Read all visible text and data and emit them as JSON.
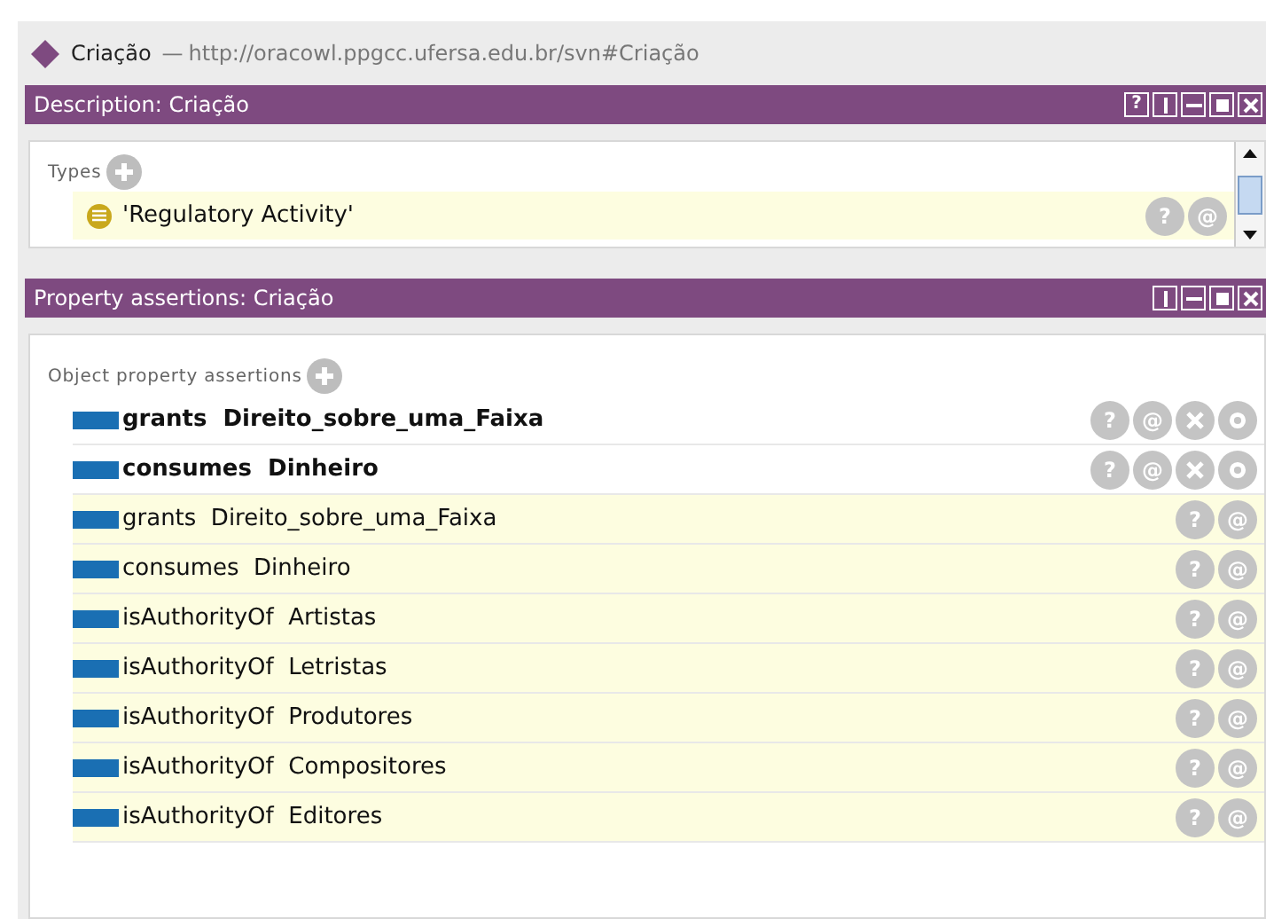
{
  "entity": {
    "name": "Criação",
    "separator": "—",
    "iri": "http://oracowl.ppgcc.ufersa.edu.br/svn#Criação"
  },
  "description": {
    "title": "Description: Criação",
    "header_buttons": [
      "?"
    ],
    "section": "Types",
    "types": [
      {
        "label": "'Regulatory Activity'",
        "buttons": [
          "?",
          "@"
        ]
      }
    ]
  },
  "property_assertions": {
    "title": "Property assertions: Criação",
    "section": "Object property assertions",
    "rows": [
      {
        "property": "grants",
        "value": "Direito_sobre_uma_Faixa",
        "inferred": false,
        "buttons": [
          "?",
          "@"
        ]
      },
      {
        "property": "consumes",
        "value": "Dinheiro",
        "inferred": false,
        "buttons": [
          "?",
          "@"
        ]
      },
      {
        "property": "grants",
        "value": "Direito_sobre_uma_Faixa",
        "inferred": true,
        "buttons": [
          "?",
          "@"
        ]
      },
      {
        "property": "consumes",
        "value": "Dinheiro",
        "inferred": true,
        "buttons": [
          "?",
          "@"
        ]
      },
      {
        "property": "isAuthorityOf",
        "value": "Artistas",
        "inferred": true,
        "buttons": [
          "?",
          "@"
        ]
      },
      {
        "property": "isAuthorityOf",
        "value": "Letristas",
        "inferred": true,
        "buttons": [
          "?",
          "@"
        ]
      },
      {
        "property": "isAuthorityOf",
        "value": "Produtores",
        "inferred": true,
        "buttons": [
          "?",
          "@"
        ]
      },
      {
        "property": "isAuthorityOf",
        "value": "Compositores",
        "inferred": true,
        "buttons": [
          "?",
          "@"
        ]
      },
      {
        "property": "isAuthorityOf",
        "value": "Editores",
        "inferred": true,
        "buttons": [
          "?",
          "@"
        ]
      }
    ]
  }
}
